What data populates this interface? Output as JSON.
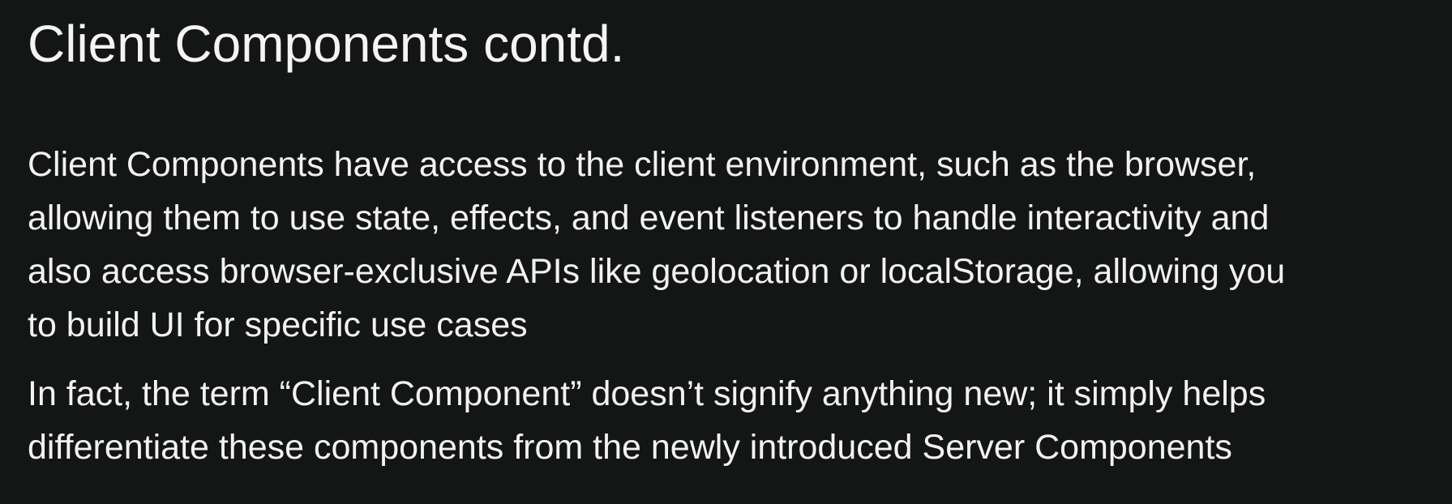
{
  "slide": {
    "title": "Client Components contd.",
    "paragraphs": [
      {
        "lines": [
          "Client Components have access to the client environment, such as the browser,",
          "allowing them to use state, effects, and event listeners to handle interactivity and",
          "also access browser-exclusive APIs like geolocation or localStorage, allowing you",
          "to build UI for specific use cases"
        ]
      },
      {
        "lines": [
          "In fact, the term “Client Component” doesn’t signify anything new; it simply helps",
          "differentiate these components from the newly introduced Server Components"
        ]
      }
    ]
  }
}
